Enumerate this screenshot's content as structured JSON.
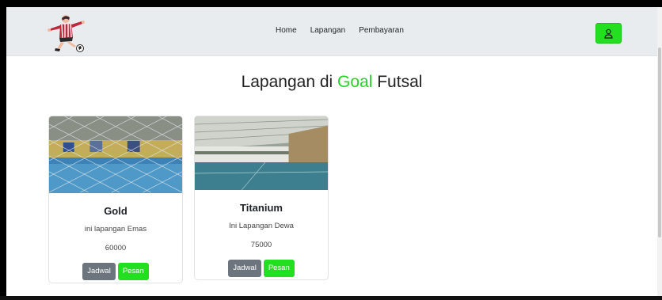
{
  "nav": {
    "links": [
      "Home",
      "Lapangan",
      "Pembayaran"
    ]
  },
  "title": {
    "prefix": "Lapangan di ",
    "accent": "Goal",
    "suffix": " Futsal"
  },
  "cards": [
    {
      "name": "Gold",
      "description": "ini lapangan Emas",
      "price": "60000",
      "schedule_label": "Jadwal",
      "order_label": "Pesan"
    },
    {
      "name": "Titanium",
      "description": "Ini Lapangan Dewa",
      "price": "75000",
      "schedule_label": "Jadwal",
      "order_label": "Pesan"
    }
  ],
  "colors": {
    "accent_green": "#22e01f",
    "secondary_gray": "#6c757d",
    "navbar_bg": "#e9ecef"
  },
  "icons": {
    "logo": "futsal-player-logo",
    "user": "user-icon"
  }
}
